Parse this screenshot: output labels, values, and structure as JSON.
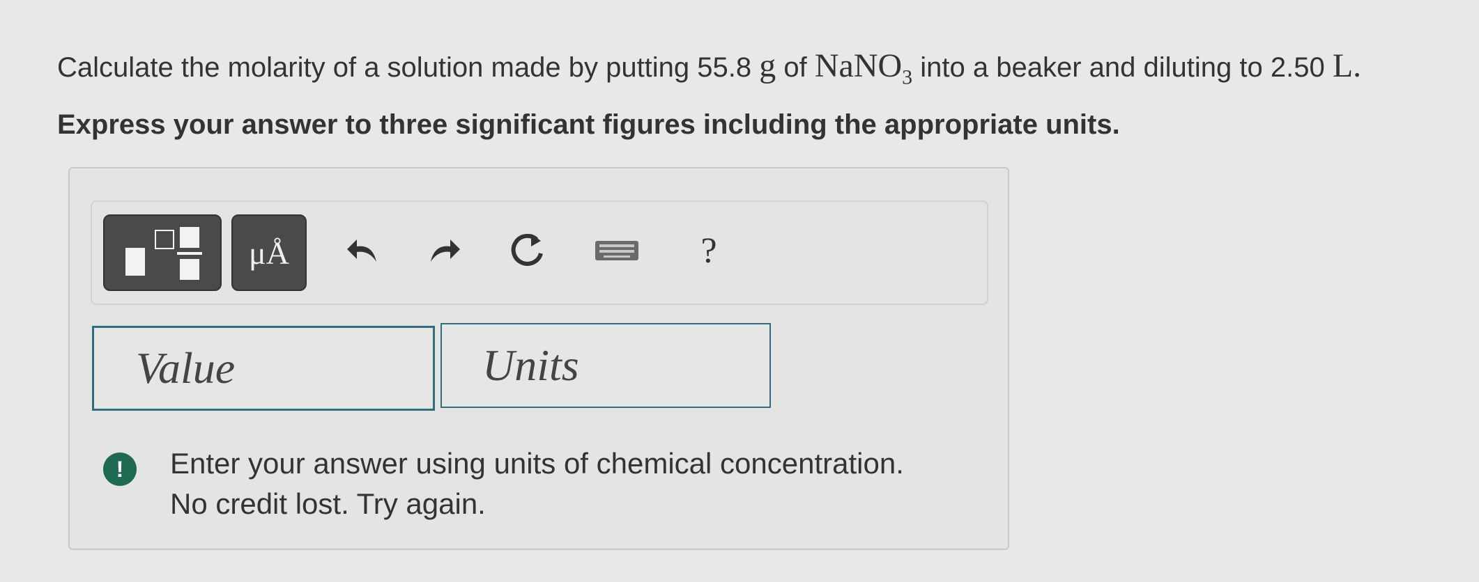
{
  "question": {
    "prefix": "Calculate the molarity of a solution made by putting 55.8",
    "mass_unit": "g",
    "of_text": "of",
    "compound_main": "NaNO",
    "compound_sub": "3",
    "middle": "into a beaker and diluting to 2.50",
    "volume_unit": "L."
  },
  "instruction": "Express your answer to three significant figures including the appropriate units.",
  "toolbar": {
    "units_label": "μÅ",
    "help_label": "?"
  },
  "inputs": {
    "value_placeholder": "Value",
    "units_placeholder": "Units"
  },
  "feedback": {
    "line1": "Enter your answer using units of chemical concentration.",
    "line2": "No credit lost. Try again.",
    "icon_label": "!"
  },
  "colors": {
    "field_border": "#2e6f7e",
    "alert_green": "#1e6a52",
    "toolbar_dark": "#4a4a4a"
  },
  "icons": [
    "templates-icon",
    "units-symbol-icon",
    "undo-icon",
    "redo-icon",
    "reset-icon",
    "keyboard-icon",
    "help-icon",
    "alert-icon"
  ]
}
